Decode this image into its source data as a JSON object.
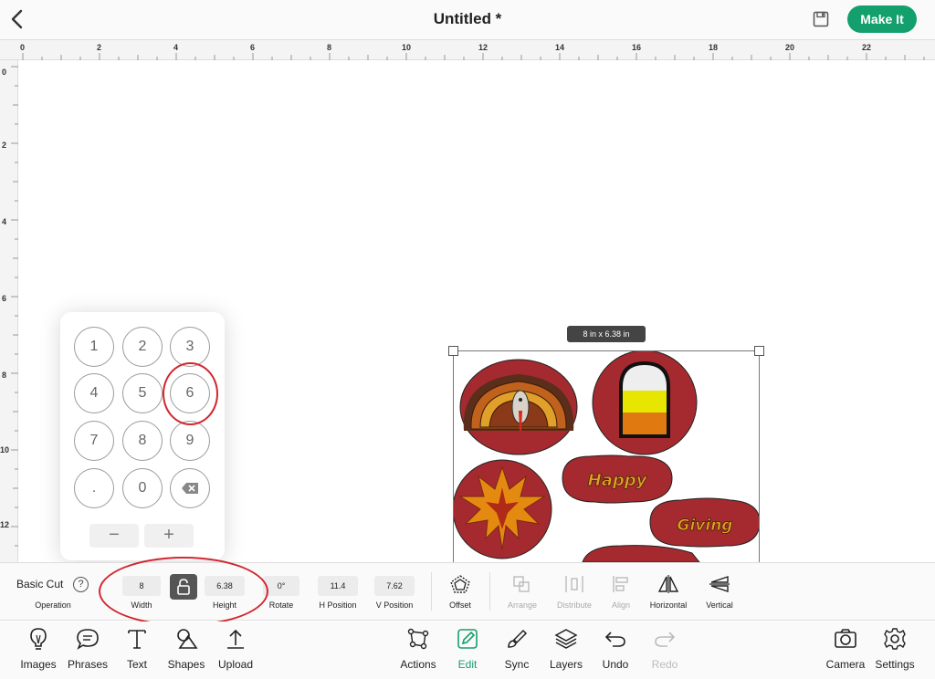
{
  "header": {
    "title": "Untitled *",
    "make_label": "Make It"
  },
  "ruler": {
    "horizontal": [
      "0",
      "2",
      "4",
      "6",
      "8",
      "10",
      "12",
      "14",
      "16",
      "18",
      "20",
      "22"
    ],
    "vertical": [
      "0",
      "2",
      "4",
      "6",
      "8",
      "10",
      "12"
    ]
  },
  "canvas": {
    "size_label": "8 in x 6.38 in",
    "design": {
      "word1": "Happy",
      "word2": "Giving"
    }
  },
  "keypad": {
    "keys": [
      "1",
      "2",
      "3",
      "4",
      "5",
      "6",
      "7",
      "8",
      "9",
      ".",
      "0"
    ],
    "minus": "−",
    "plus": "+"
  },
  "toolbar": {
    "operation_value": "Basic Cut",
    "operation_label": "Operation",
    "help": "?",
    "width_value": "8",
    "width_label": "Width",
    "height_value": "6.38",
    "height_label": "Height",
    "rotate_value": "0°",
    "rotate_label": "Rotate",
    "hpos_value": "11.4",
    "hpos_label": "H Position",
    "vpos_value": "7.62",
    "vpos_label": "V Position",
    "offset_label": "Offset",
    "arrange_label": "Arrange",
    "distribute_label": "Distribute",
    "align_label": "Align",
    "horizontal_label": "Horizontal",
    "vertical_label": "Vertical"
  },
  "bottom": {
    "images": "Images",
    "phrases": "Phrases",
    "text": "Text",
    "shapes": "Shapes",
    "upload": "Upload",
    "actions": "Actions",
    "edit": "Edit",
    "sync": "Sync",
    "layers": "Layers",
    "undo": "Undo",
    "redo": "Redo",
    "camera": "Camera",
    "settings": "Settings"
  },
  "colors": {
    "accent": "#14a06c",
    "annotation": "#d3262f",
    "design_red": "#a42a2f"
  }
}
